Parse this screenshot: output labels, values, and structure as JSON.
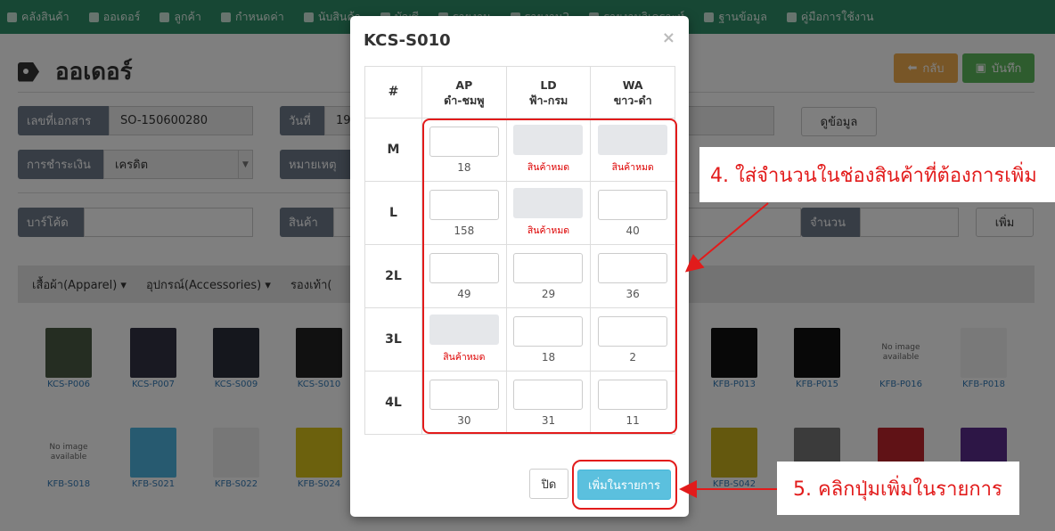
{
  "nav": [
    {
      "icon": "warehouse-icon",
      "label": "คลังสินค้า"
    },
    {
      "icon": "cart-icon",
      "label": "ออเดอร์"
    },
    {
      "icon": "user-icon",
      "label": "ลูกค้า"
    },
    {
      "icon": "gear-icon",
      "label": "กำหนดค่า"
    },
    {
      "icon": "checkbox-icon",
      "label": "นับสินค้า"
    },
    {
      "icon": "dollar-icon",
      "label": "บัญชี"
    },
    {
      "icon": "bar-chart-icon",
      "label": "รายงาน"
    },
    {
      "icon": "bar-chart-icon",
      "label": "รายงาน2"
    },
    {
      "icon": "bar-chart-icon",
      "label": "รายงานวิเคราะห์"
    },
    {
      "icon": "database-icon",
      "label": "ฐานข้อมูล"
    },
    {
      "icon": "book-icon",
      "label": "คู่มือการใช้งาน"
    }
  ],
  "page": {
    "title": "ออเดอร์",
    "back_label": "กลับ",
    "save_label": "บันทึก"
  },
  "form": {
    "doc_no_label": "เลขที่เอกสาร",
    "doc_no_value": "SO-150600280",
    "date_label": "วันที่",
    "date_value": "19",
    "view_label": "ดูข้อมูล",
    "payment_label": "การชำระเงิน",
    "payment_value": "เครดิต",
    "note_label": "หมายเหตุ",
    "barcode_label": "บาร์โค้ด",
    "product_label": "สินค้า",
    "qty_label": "จำนวน",
    "add_label": "เพิ่ม"
  },
  "categories": [
    "เสื้อผ้า(Apparel)",
    "อุปกรณ์(Accessories)",
    "รองเท้า("
  ],
  "products_row1": [
    {
      "code": "KCS-P006",
      "color": "#4a5a44"
    },
    {
      "code": "KCS-P007",
      "color": "#334"
    },
    {
      "code": "KCS-S009",
      "color": "#2a2f3a"
    },
    {
      "code": "KCS-S010",
      "color": "#222"
    },
    {
      "code": "KFB-P013",
      "color": "#111"
    },
    {
      "code": "KFB-P015",
      "color": "#111"
    },
    {
      "code": "KFB-P016",
      "noimage": "No image available"
    },
    {
      "code": "KFB-P018",
      "color": "#f3f3f3"
    }
  ],
  "products_row2": [
    {
      "code": "KFB-S018",
      "noimage": "No image available"
    },
    {
      "code": "KFB-S021",
      "color": "#4fb4e0"
    },
    {
      "code": "KFB-S022",
      "color": "#eee"
    },
    {
      "code": "KFB-S024",
      "color": "#d8c21a"
    },
    {
      "code": "KFB-S042",
      "color": "#c9b11c"
    },
    {
      "code": "",
      "color": "#777"
    },
    {
      "code": "",
      "color": "#c0252d"
    },
    {
      "code": "",
      "color": "#5b2d8d"
    }
  ],
  "modal": {
    "title": "KCS-S010",
    "close_glyph": "×",
    "corner_header": "#",
    "colors": [
      {
        "code": "AP",
        "name": "ดำ-ชมพู"
      },
      {
        "code": "LD",
        "name": "ฟ้า-กรม"
      },
      {
        "code": "WA",
        "name": "ขาว-ดำ"
      }
    ],
    "rows": [
      {
        "size": "M",
        "cells": [
          {
            "stock": "18",
            "out": false
          },
          {
            "stock": "สินค้าหมด",
            "out": true
          },
          {
            "stock": "สินค้าหมด",
            "out": true
          }
        ]
      },
      {
        "size": "L",
        "cells": [
          {
            "stock": "158",
            "out": false
          },
          {
            "stock": "สินค้าหมด",
            "out": true
          },
          {
            "stock": "40",
            "out": false
          }
        ]
      },
      {
        "size": "2L",
        "cells": [
          {
            "stock": "49",
            "out": false
          },
          {
            "stock": "29",
            "out": false
          },
          {
            "stock": "36",
            "out": false
          }
        ]
      },
      {
        "size": "3L",
        "cells": [
          {
            "stock": "สินค้าหมด",
            "out": true
          },
          {
            "stock": "18",
            "out": false
          },
          {
            "stock": "2",
            "out": false
          }
        ]
      },
      {
        "size": "4L",
        "cells": [
          {
            "stock": "30",
            "out": false
          },
          {
            "stock": "31",
            "out": false
          },
          {
            "stock": "11",
            "out": false
          }
        ]
      }
    ],
    "close_label": "ปิด",
    "add_to_list_label": "เพิ่มในรายการ"
  },
  "annotations": {
    "step4": "4. ใส่จำนวนในช่องสินค้าที่ต้องการเพิ่ม",
    "step5": "5. คลิกปุ่มเพิ่มในรายการ",
    "accent": "#e21b1b"
  }
}
